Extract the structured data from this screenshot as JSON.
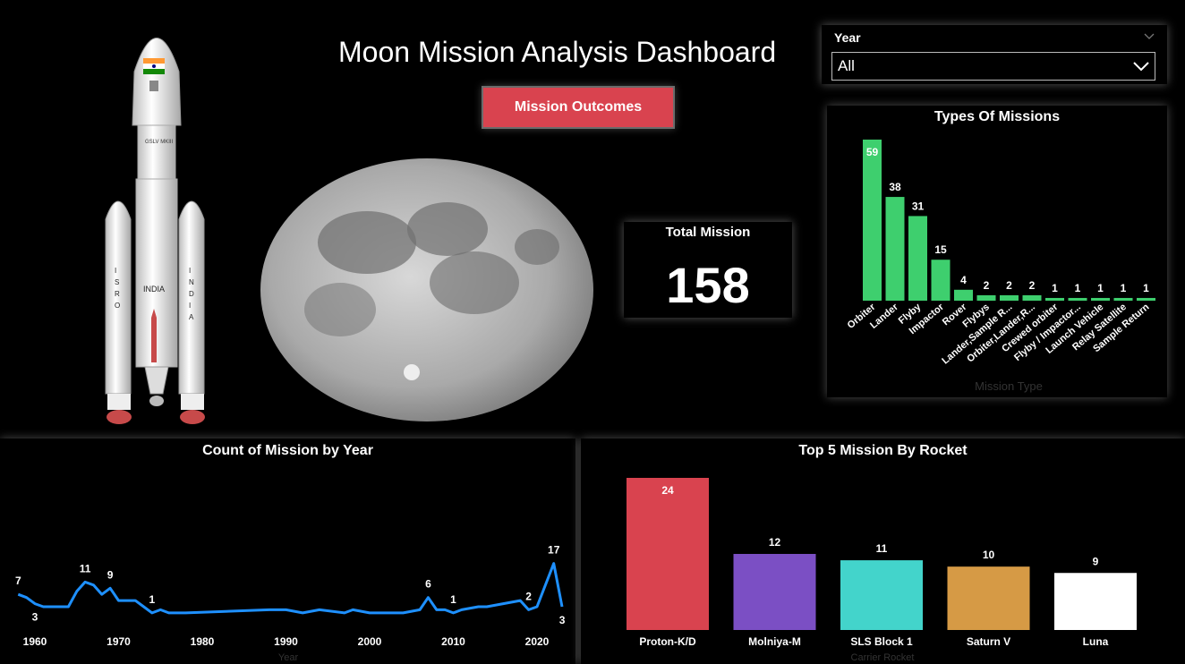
{
  "dashboard": {
    "title": "Moon Mission Analysis Dashboard",
    "outcomes_button": "Mission Outcomes",
    "accent_color": "#d9434f"
  },
  "rocket_image": {
    "stages": [
      {
        "label": "ISRO"
      },
      {
        "label": "INDIA"
      },
      {
        "label": "INDIA"
      }
    ],
    "model": "GSLV MKIII"
  },
  "slicer": {
    "label": "Year",
    "value": "All"
  },
  "card": {
    "label": "Total Mission",
    "value": "158"
  },
  "types_chart": {
    "title": "Types Of Missions",
    "chart_data": {
      "type": "bar",
      "categories": [
        "Orbiter",
        "Lander",
        "Flyby",
        "Impactor",
        "Rover",
        "Flybys",
        "Lander,Sample R...",
        "Orbiter,Lander,R...",
        "Crewed orbiter",
        "Flyby / Impactor...",
        "Launch Vehicle",
        "Relay Satellite",
        "Sample Return"
      ],
      "values": [
        59,
        38,
        31,
        15,
        4,
        2,
        2,
        2,
        1,
        1,
        1,
        1,
        1
      ],
      "xlabel": "Mission Type",
      "color": "#3ecf6e"
    }
  },
  "year_chart": {
    "title": "Count of Mission by Year",
    "chart_data": {
      "type": "line",
      "x": [
        1958,
        1959,
        1960,
        1961,
        1962,
        1963,
        1964,
        1965,
        1966,
        1967,
        1968,
        1969,
        1970,
        1971,
        1972,
        1973,
        1974,
        1975,
        1976,
        1977,
        1978,
        1988,
        1990,
        1992,
        1994,
        1997,
        1998,
        2000,
        2001,
        2003,
        2004,
        2006,
        2007,
        2008,
        2009,
        2010,
        2011,
        2013,
        2014,
        2018,
        2019,
        2020,
        2022,
        2023
      ],
      "y": [
        7,
        6,
        4,
        3,
        3,
        3,
        3,
        8,
        11,
        10,
        7,
        9,
        5,
        5,
        5,
        3,
        1,
        2,
        1,
        1,
        1,
        2,
        2,
        1,
        2,
        1,
        2,
        1,
        1,
        1,
        1,
        2,
        6,
        2,
        2,
        1,
        2,
        3,
        3,
        5,
        2,
        3,
        17,
        3
      ],
      "labels": [
        {
          "year": 1958,
          "value": "7"
        },
        {
          "year": 1960,
          "value": "3"
        },
        {
          "year": 1966,
          "value": "11"
        },
        {
          "year": 1969,
          "value": "9"
        },
        {
          "year": 1974,
          "value": "1"
        },
        {
          "year": 2007,
          "value": "6"
        },
        {
          "year": 2010,
          "value": "1"
        },
        {
          "year": 2019,
          "value": "2"
        },
        {
          "year": 2022,
          "value": "17"
        },
        {
          "year": 2023,
          "value": "3"
        }
      ],
      "xticks": [
        "1960",
        "1970",
        "1980",
        "1990",
        "2000",
        "2010",
        "2020"
      ],
      "xlabel": "Year",
      "color": "#1e90ff"
    }
  },
  "rocket_chart": {
    "title": "Top 5 Mission By Rocket",
    "chart_data": {
      "type": "bar",
      "categories": [
        "Proton-K/D",
        "Molniya-M",
        "SLS Block 1",
        "Saturn V",
        "Luna"
      ],
      "values": [
        24,
        12,
        11,
        10,
        9
      ],
      "colors": [
        "#d9434f",
        "#7b4fc4",
        "#43d4cb",
        "#d69a45",
        "#ffffff"
      ],
      "xlabel": "Carrier Rocket"
    }
  }
}
